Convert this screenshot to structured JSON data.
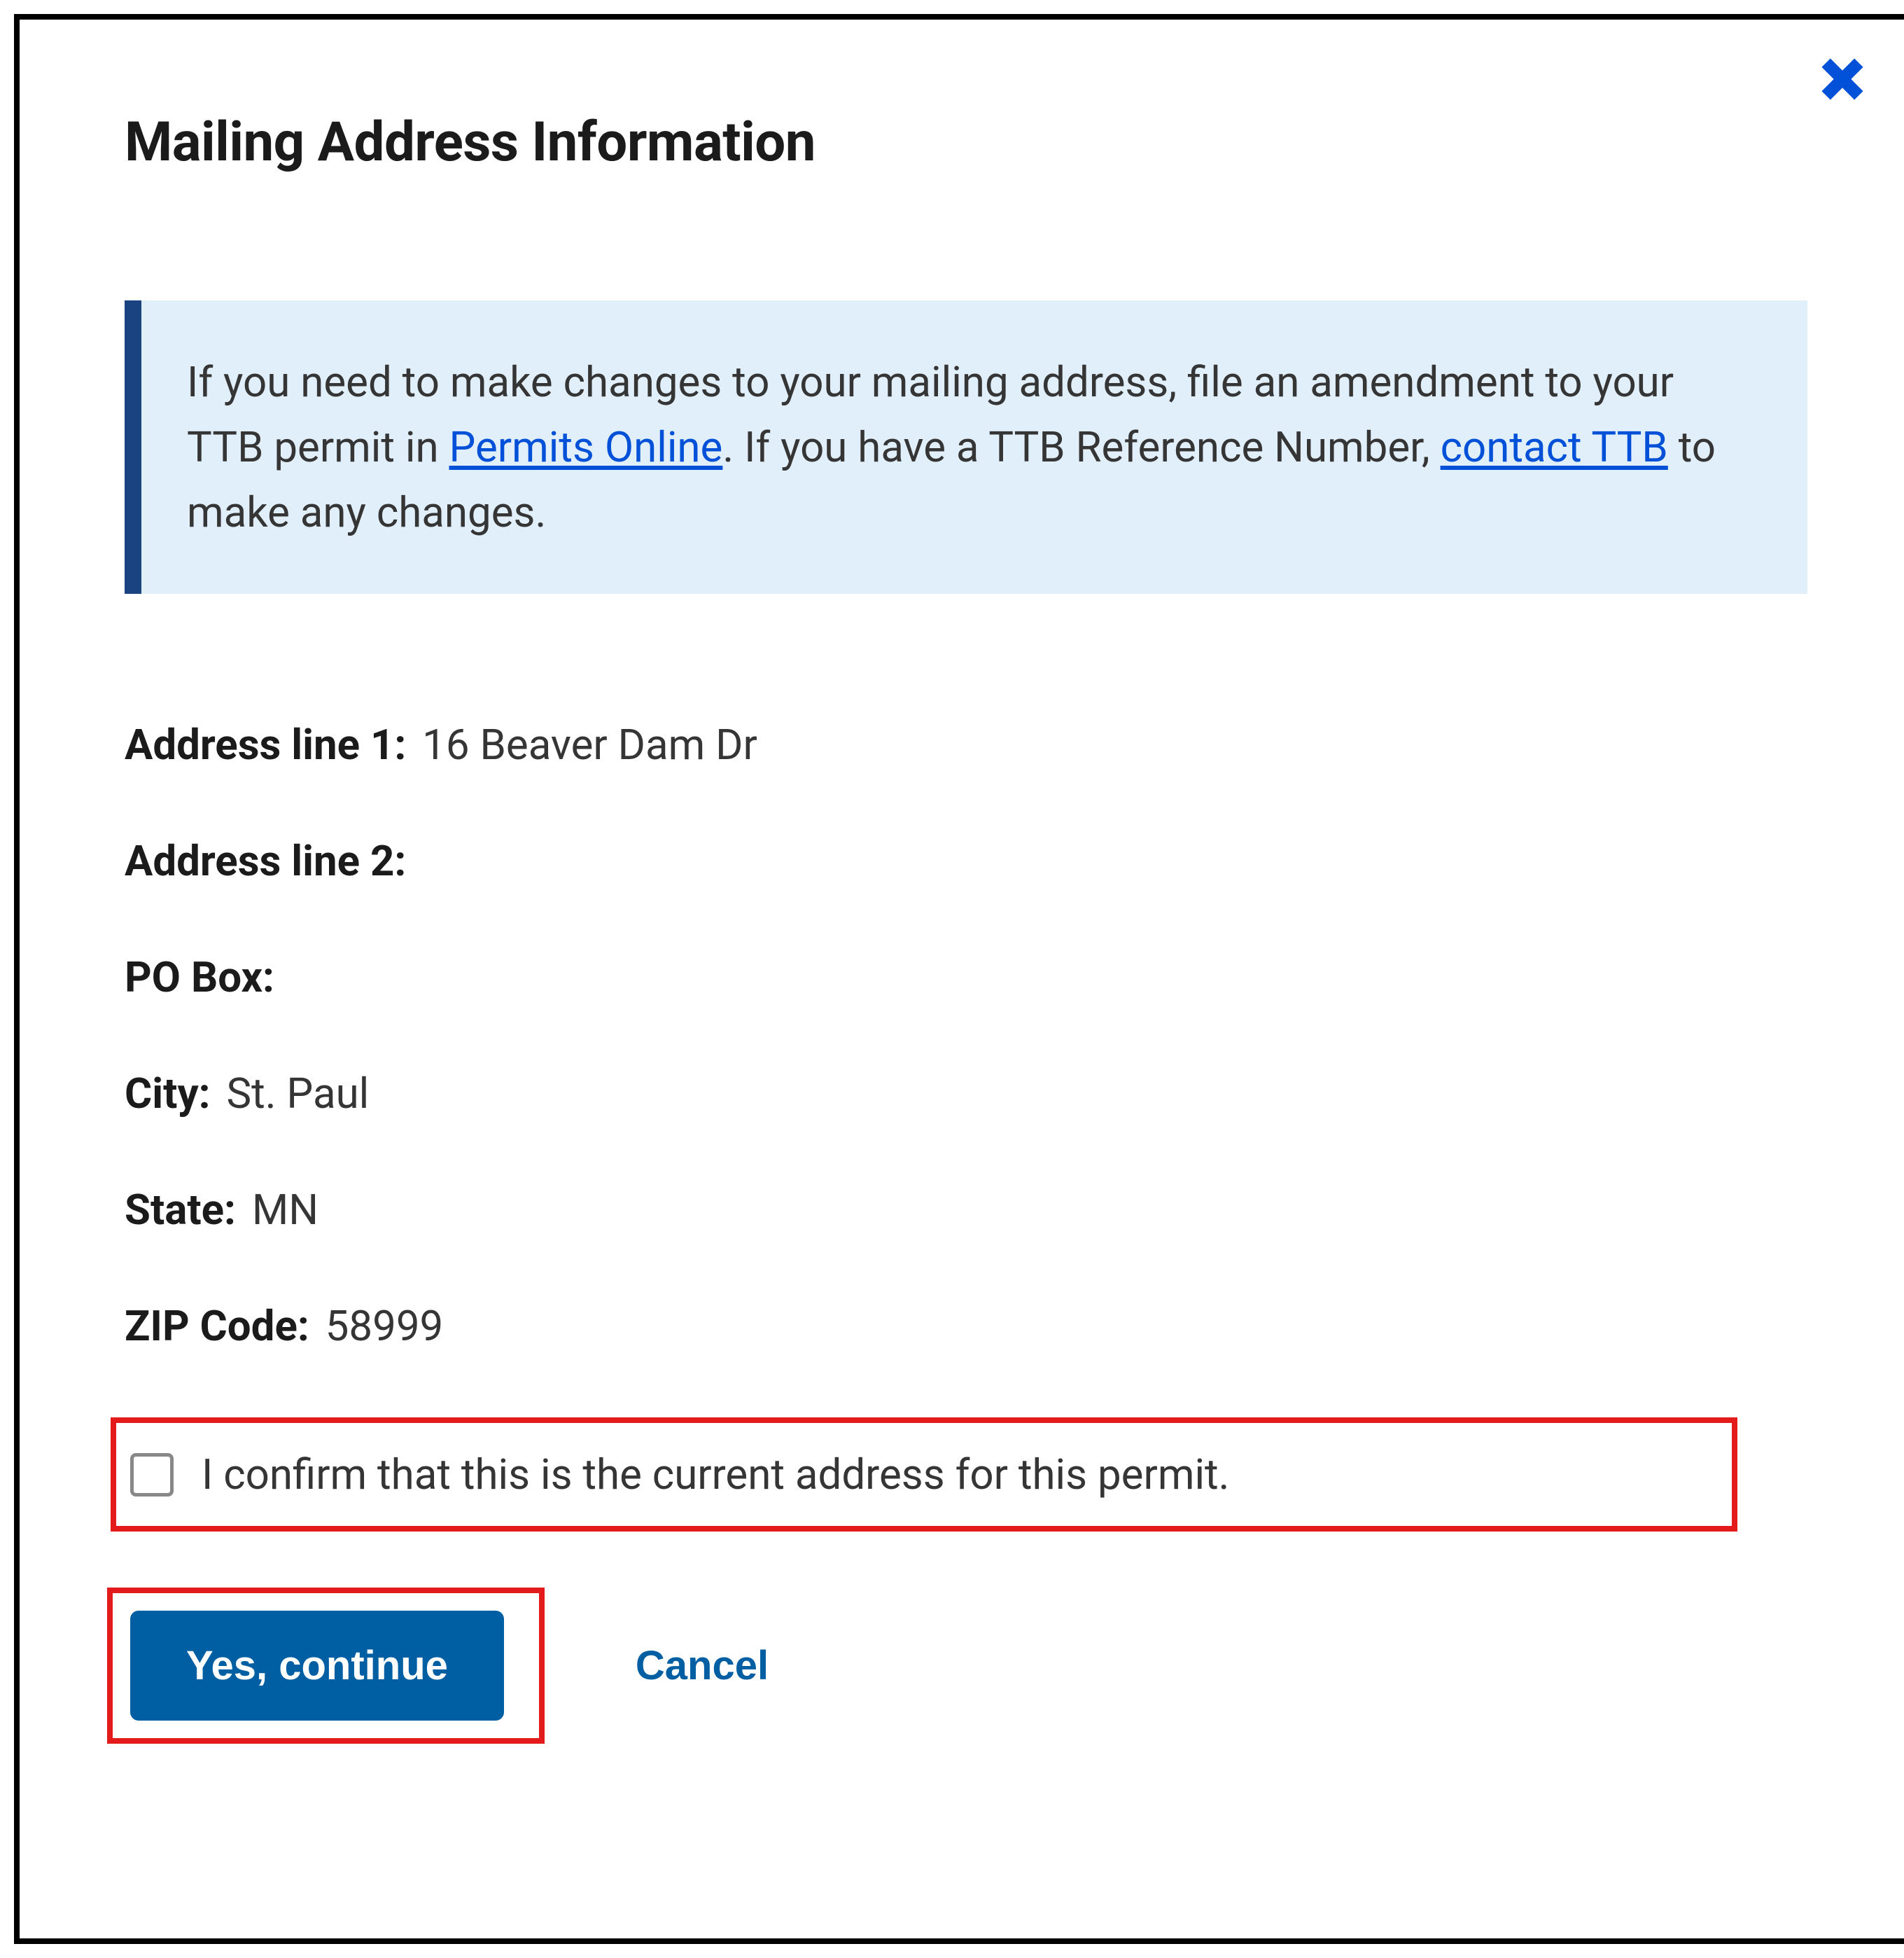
{
  "modal": {
    "title": "Mailing Address Information",
    "info": {
      "text_before_link1": "If you need to make changes to your mailing address, file an amendment to your TTB permit in ",
      "link1": "Permits Online",
      "text_between": ". If you have a TTB Reference Number, ",
      "link2": "contact TTB",
      "text_after": " to make any changes."
    },
    "fields": {
      "address1_label": "Address line 1:",
      "address1_value": "16 Beaver Dam Dr",
      "address2_label": "Address line 2:",
      "address2_value": "",
      "pobox_label": "PO Box:",
      "pobox_value": "",
      "city_label": "City:",
      "city_value": "St. Paul",
      "state_label": "State:",
      "state_value": "MN",
      "zip_label": "ZIP Code:",
      "zip_value": "58999"
    },
    "checkbox_label": "I confirm that this is the current address for this permit.",
    "buttons": {
      "primary": "Yes, continue",
      "cancel": "Cancel"
    }
  }
}
